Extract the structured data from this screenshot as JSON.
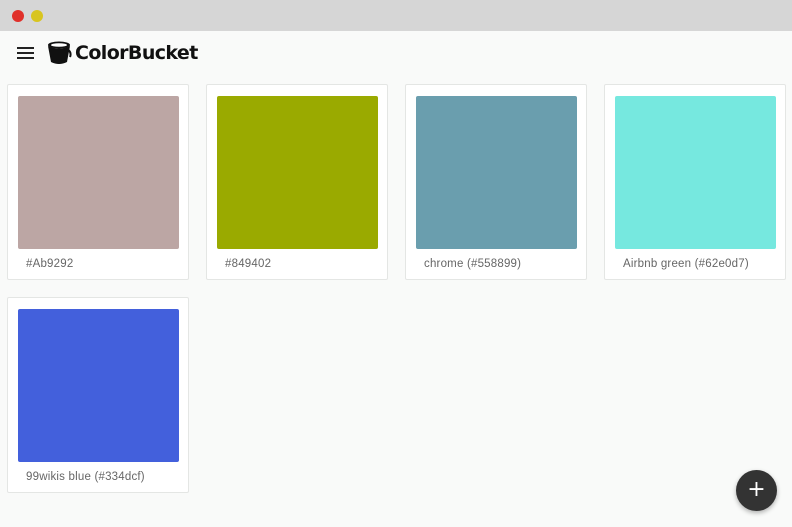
{
  "app": {
    "name": "ColorBucket"
  },
  "window": {
    "controls": [
      "close",
      "minimize"
    ]
  },
  "header": {
    "menu_icon": "hamburger-menu-icon",
    "logo_icon": "bucket-icon"
  },
  "colors": [
    {
      "label": "#Ab9292",
      "hex": "#bca6a4"
    },
    {
      "label": "#849402",
      "hex": "#9aaa00"
    },
    {
      "label": "chrome (#558899)",
      "hex": "#6a9eae"
    },
    {
      "label": "Airbnb green (#62e0d7)",
      "hex": "#76e8df"
    },
    {
      "label": "99wikis blue (#334dcf)",
      "hex": "#4360dc"
    }
  ],
  "fab": {
    "icon": "plus-icon",
    "symbol": "+"
  }
}
